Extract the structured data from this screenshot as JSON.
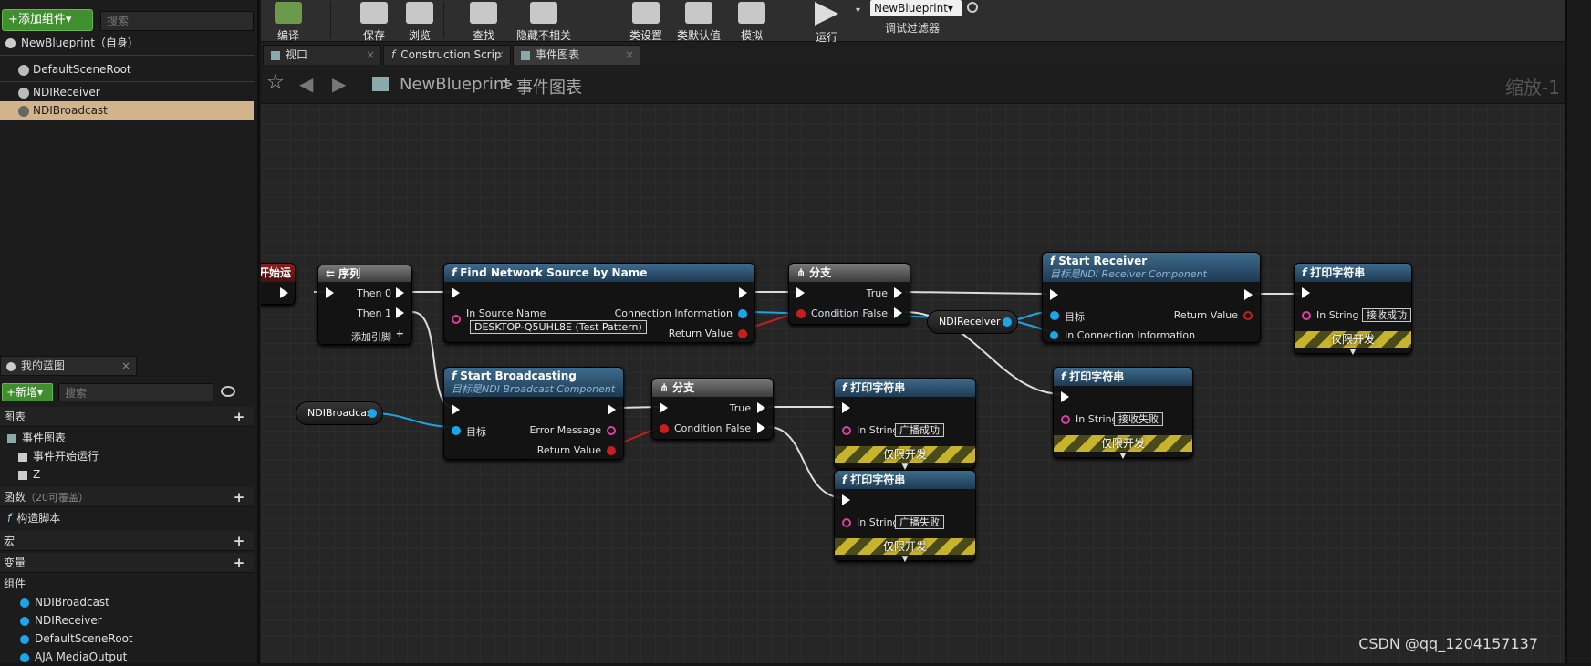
{
  "left": {
    "add_component": "+添加组件▾",
    "search_placeholder": "搜索",
    "self_item": "NewBlueprint（自身）",
    "tree": [
      "DefaultSceneRoot",
      "NDIReceiver",
      "NDIBroadcast"
    ],
    "my_bp_tab": "我的蓝图",
    "new_button": "+新增▾",
    "sections": {
      "graph": "图表",
      "event_graph": "事件图表",
      "event_begin": "事件开始运行",
      "z": "Z",
      "functions": "函数",
      "functions_note": "（20可覆盖）",
      "construct": "构造脚本",
      "macros": "宏",
      "variables": "变量",
      "components": "组件",
      "comp_items": [
        "NDIBroadcast",
        "NDIReceiver",
        "DefaultSceneRoot",
        "AJA MediaOutput"
      ]
    }
  },
  "toolbar": {
    "items": [
      "编译",
      "保存",
      "浏览",
      "查找",
      "隐藏不相关",
      "类设置",
      "类默认值",
      "模拟",
      "运行"
    ],
    "debug_object": "NewBlueprint▾",
    "debug_filter": "调试过滤器"
  },
  "tabs": [
    "视口",
    "Construction Scrip",
    "事件图表"
  ],
  "crumb": {
    "root": "NewBlueprint",
    "sep": ">",
    "leaf": "事件图表",
    "zoom": "缩放-1"
  },
  "nodes": {
    "event_begin": "开始运行",
    "sequence": {
      "title": "序列",
      "then0": "Then 0",
      "then1": "Then 1",
      "add_pin": "添加引脚"
    },
    "find_source": {
      "title": "Find Network Source by Name",
      "in_source": "In Source Name",
      "in_value": "DESKTOP-Q5UHL8E (Test Pattern)",
      "conn_info": "Connection Information",
      "ret": "Return Value"
    },
    "branch1": {
      "title": "分支",
      "cond": "Condition",
      "t": "True",
      "f": "False"
    },
    "ndi_receiver_var": "NDIReceiver",
    "start_receiver": {
      "title": "Start Receiver",
      "sub": "目标是NDI Receiver Component",
      "target": "目标",
      "conn": "In Connection Information",
      "ret": "Return Value"
    },
    "print_ok_recv": {
      "title": "打印字符串",
      "in": "In String",
      "val": "接收成功",
      "dev": "仅限开发"
    },
    "print_fail_recv": {
      "title": "打印字符串",
      "in": "In String",
      "val": "接收失败",
      "dev": "仅限开发"
    },
    "ndi_broadcast_var": "NDIBroadcast",
    "start_broadcast": {
      "title": "Start Broadcasting",
      "sub": "目标是NDI Broadcast Component",
      "target": "目标",
      "err": "Error Message",
      "ret": "Return Value"
    },
    "branch2": {
      "title": "分支",
      "cond": "Condition",
      "t": "True",
      "f": "False"
    },
    "print_ok_bc": {
      "title": "打印字符串",
      "in": "In String",
      "val": "广播成功",
      "dev": "仅限开发"
    },
    "print_fail_bc": {
      "title": "打印字符串",
      "in": "In String",
      "val": "广播失败",
      "dev": "仅限开发"
    }
  },
  "watermark": "CSDN @qq_1204157137"
}
